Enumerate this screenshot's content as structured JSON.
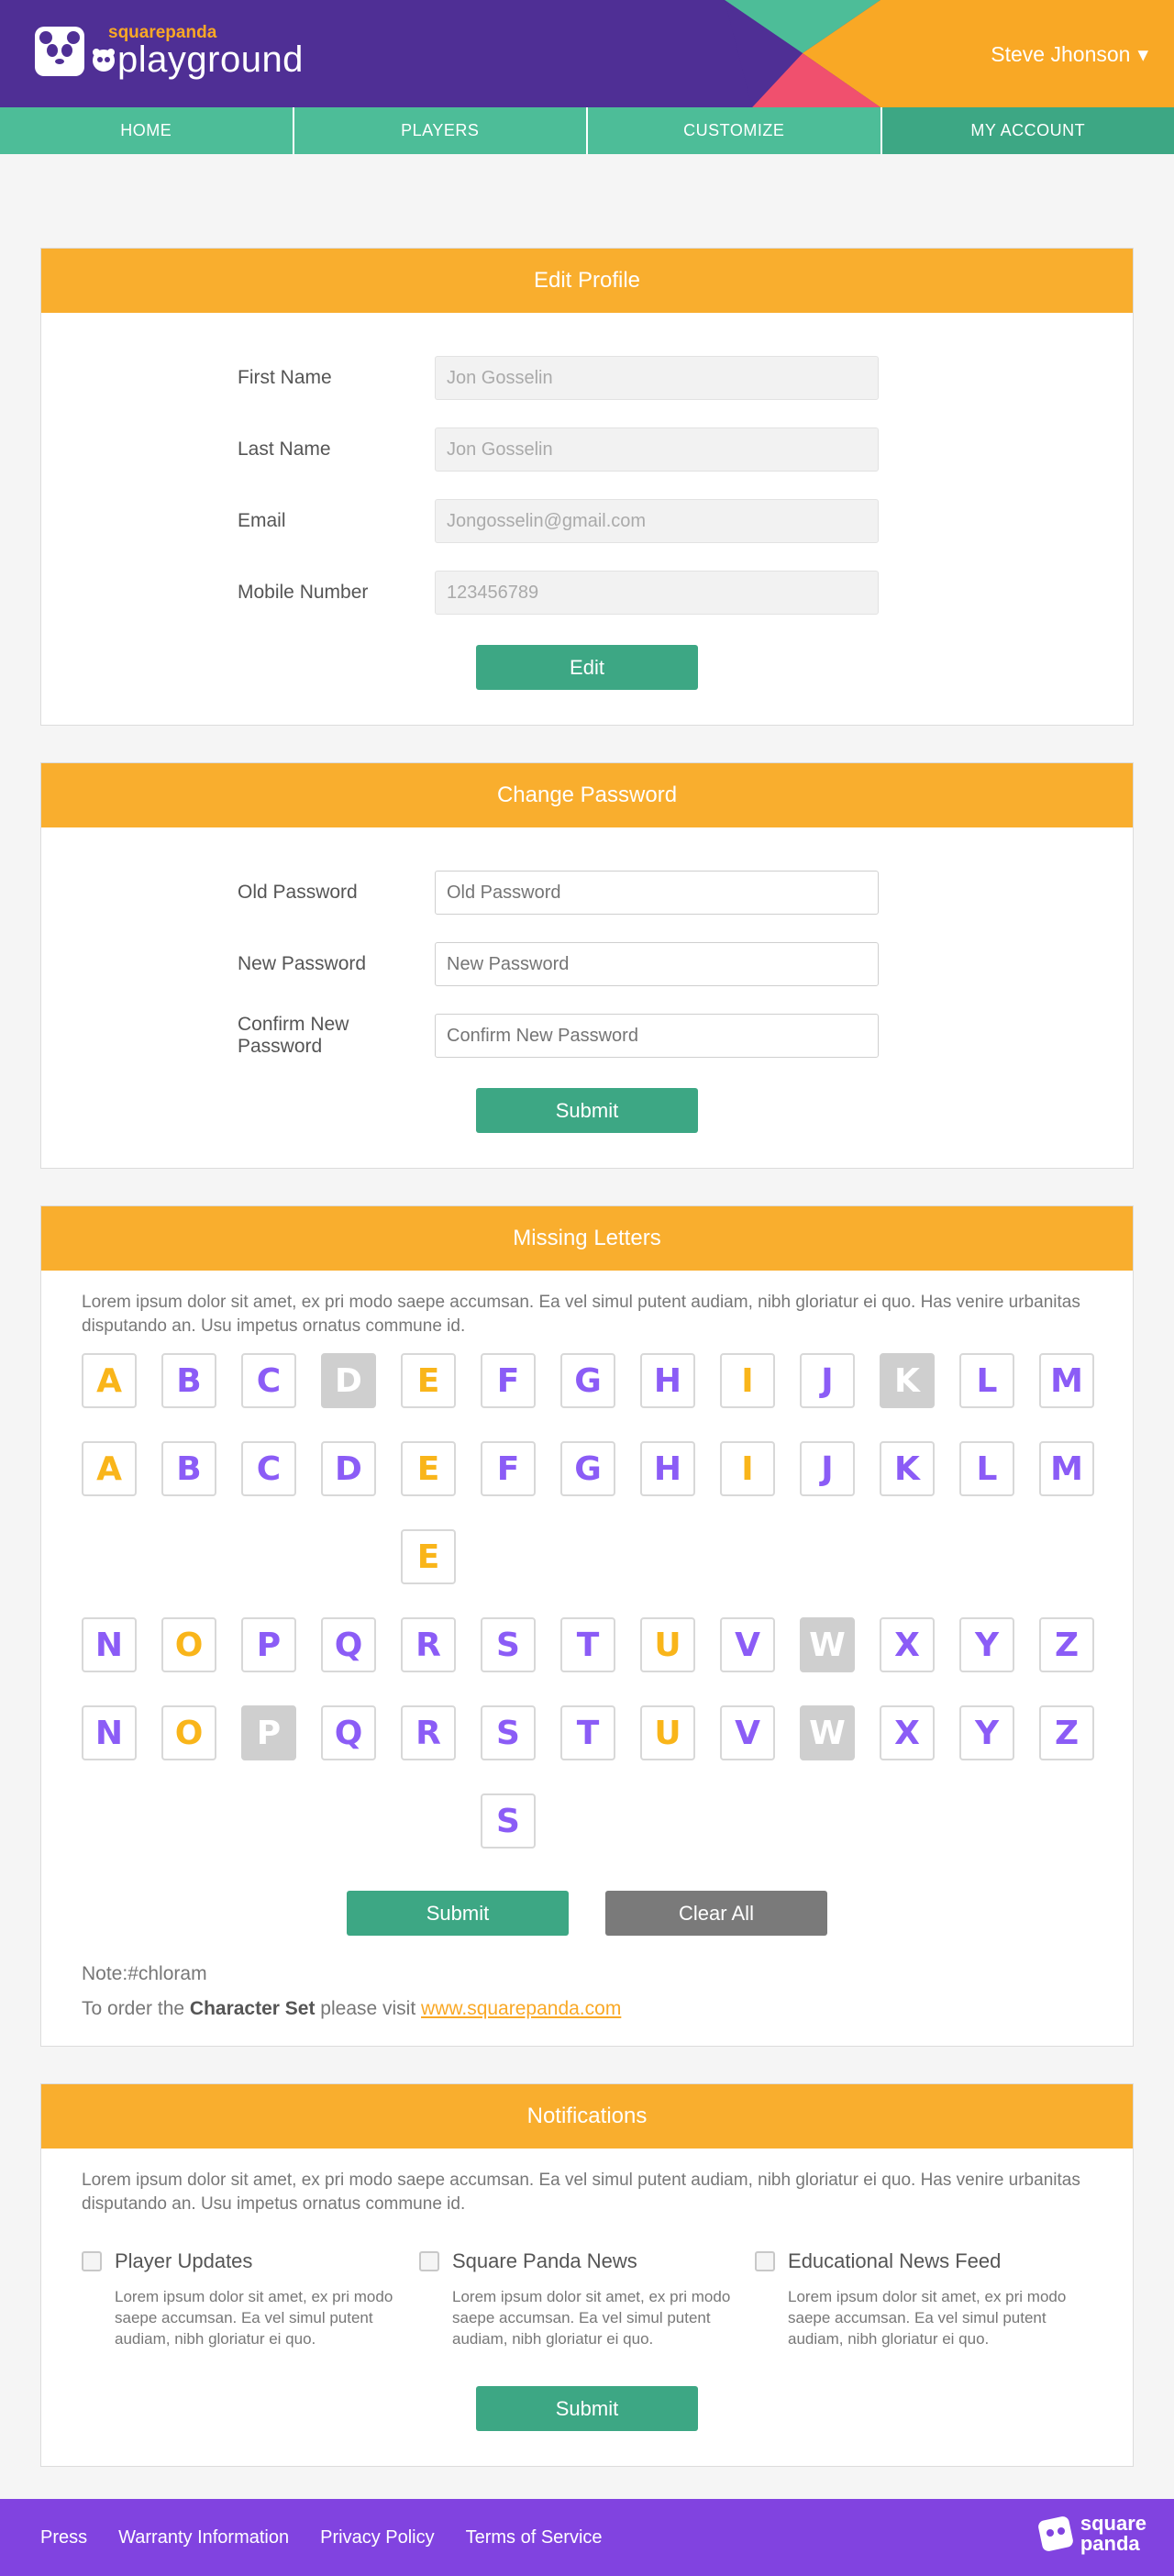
{
  "brand": {
    "small": "squarepanda",
    "big": "playground",
    "footer_logo": [
      "square",
      "panda"
    ]
  },
  "user": {
    "name": "Steve Jhonson",
    "caret": "▾"
  },
  "nav": [
    "HOME",
    "PLAYERS",
    "CUSTOMIZE",
    "MY ACCOUNT"
  ],
  "edit_profile": {
    "title": "Edit Profile",
    "fields": [
      {
        "label": "First Name",
        "value": "Jon Gosselin"
      },
      {
        "label": "Last Name",
        "value": "Jon Gosselin"
      },
      {
        "label": "Email",
        "value": "Jongosselin@gmail.com"
      },
      {
        "label": "Mobile Number",
        "value": "123456789"
      }
    ],
    "button": "Edit"
  },
  "change_password": {
    "title": "Change Password",
    "fields": [
      {
        "label": "Old Password",
        "placeholder": "Old Password"
      },
      {
        "label": "New Password",
        "placeholder": "New Password"
      },
      {
        "label": "Confirm New Password",
        "placeholder": "Confirm New Password"
      }
    ],
    "button": "Submit"
  },
  "missing_letters": {
    "title": "Missing Letters",
    "description": "Lorem ipsum dolor sit amet, ex pri modo saepe accumsan. Ea vel simul putent audiam, nibh gloriatur ei quo. Has venire urbanitas disputando an. Usu impetus ornatus commune id.",
    "rows": [
      [
        [
          "A",
          "y"
        ],
        [
          "B",
          "v"
        ],
        [
          "C",
          "v"
        ],
        [
          "D",
          "g"
        ],
        [
          "E",
          "y"
        ],
        [
          "F",
          "v"
        ],
        [
          "G",
          "v"
        ],
        [
          "H",
          "v"
        ],
        [
          "I",
          "y"
        ],
        [
          "J",
          "v"
        ],
        [
          "K",
          "g"
        ],
        [
          "L",
          "v"
        ],
        [
          "M",
          "v"
        ]
      ],
      [
        [
          "A",
          "y"
        ],
        [
          "B",
          "v"
        ],
        [
          "C",
          "v"
        ],
        [
          "D",
          "v"
        ],
        [
          "E",
          "y"
        ],
        [
          "F",
          "v"
        ],
        [
          "G",
          "v"
        ],
        [
          "H",
          "v"
        ],
        [
          "I",
          "y"
        ],
        [
          "J",
          "v"
        ],
        [
          "K",
          "v"
        ],
        [
          "L",
          "v"
        ],
        [
          "M",
          "v"
        ]
      ],
      [
        [
          "",
          ""
        ],
        [
          "",
          ""
        ],
        [
          "",
          ""
        ],
        [
          "",
          ""
        ],
        [
          "E",
          "y"
        ]
      ],
      [
        [
          "N",
          "v"
        ],
        [
          "O",
          "y"
        ],
        [
          "P",
          "v"
        ],
        [
          "Q",
          "v"
        ],
        [
          "R",
          "v"
        ],
        [
          "S",
          "v"
        ],
        [
          "T",
          "v"
        ],
        [
          "U",
          "y"
        ],
        [
          "V",
          "v"
        ],
        [
          "W",
          "g"
        ],
        [
          "X",
          "v"
        ],
        [
          "Y",
          "v"
        ],
        [
          "Z",
          "v"
        ]
      ],
      [
        [
          "N",
          "v"
        ],
        [
          "O",
          "y"
        ],
        [
          "P",
          "g"
        ],
        [
          "Q",
          "v"
        ],
        [
          "R",
          "v"
        ],
        [
          "S",
          "v"
        ],
        [
          "T",
          "v"
        ],
        [
          "U",
          "y"
        ],
        [
          "V",
          "v"
        ],
        [
          "W",
          "g"
        ],
        [
          "X",
          "v"
        ],
        [
          "Y",
          "v"
        ],
        [
          "Z",
          "v"
        ]
      ],
      [
        [
          "",
          ""
        ],
        [
          "",
          ""
        ],
        [
          "",
          ""
        ],
        [
          "",
          ""
        ],
        [
          "",
          ""
        ],
        [
          "S",
          "v"
        ]
      ]
    ],
    "submit": "Submit",
    "clear": "Clear All",
    "note": "Note:#chloram",
    "order_prefix": "To order the ",
    "order_bold": "Character Set",
    "order_mid": " please visit ",
    "order_link": "www.squarepanda.com"
  },
  "notifications": {
    "title": "Notifications",
    "description": "Lorem ipsum dolor sit amet, ex pri modo saepe accumsan. Ea vel simul putent audiam, nibh gloriatur ei quo. Has venire urbanitas disputando an. Usu impetus ornatus commune id.",
    "options": [
      {
        "label": "Player Updates",
        "desc": "Lorem ipsum dolor sit amet, ex pri modo saepe accumsan. Ea vel simul putent audiam, nibh gloriatur ei quo."
      },
      {
        "label": "Square Panda News",
        "desc": "Lorem ipsum dolor sit amet, ex pri modo saepe accumsan. Ea vel simul putent audiam, nibh gloriatur ei quo."
      },
      {
        "label": "Educational News Feed",
        "desc": "Lorem ipsum dolor sit amet, ex pri modo saepe accumsan. Ea vel simul putent audiam, nibh gloriatur ei quo."
      }
    ],
    "button": "Submit"
  },
  "footer": {
    "links": [
      "Press",
      "Warranty Information",
      "Privacy Policy",
      "Terms of Service"
    ]
  },
  "colors": {
    "purple": "#4f2f95",
    "orange": "#f9ae2e",
    "green": "#3da784",
    "teal": "#4dbd98",
    "footer": "#8143e0",
    "letter_violet": "#8b5cf6",
    "letter_yellow": "#f9b51a"
  }
}
